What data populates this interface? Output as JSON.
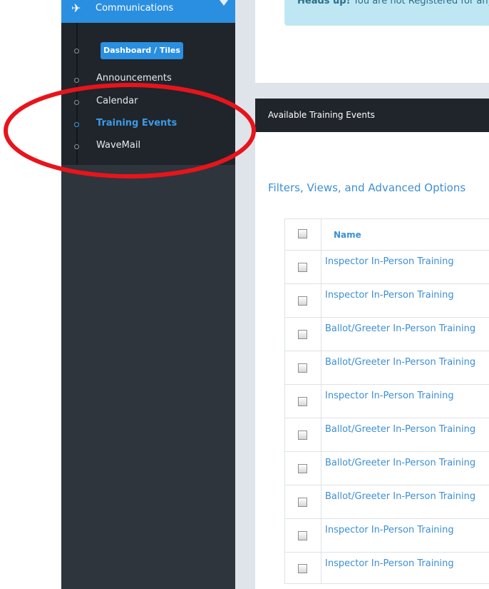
{
  "sidebar": {
    "section_label": "Communications",
    "section_icon": "paper-plane-icon",
    "dashboard_button": "Dashboard / Tiles",
    "items": [
      {
        "label": "Announcements",
        "active": false
      },
      {
        "label": "Calendar",
        "active": false
      },
      {
        "label": "Training Events",
        "active": true
      },
      {
        "label": "WaveMail",
        "active": false
      }
    ]
  },
  "alert": {
    "strong": "Heads up!",
    "text": "You are not Registered for any"
  },
  "panel": {
    "title": "Available Training Events",
    "filters_link": "Filters, Views, and Advanced Options"
  },
  "table": {
    "header": "Name",
    "rows": [
      "Inspector In-Person Training",
      "Inspector In-Person Training",
      "Ballot/Greeter In-Person Training",
      "Ballot/Greeter In-Person Training",
      "Inspector In-Person Training",
      "Ballot/Greeter In-Person Training",
      "Ballot/Greeter In-Person Training",
      "Ballot/Greeter In-Person Training",
      "Inspector In-Person Training",
      "Inspector In-Person Training"
    ]
  },
  "colors": {
    "accent": "#2a8fe0",
    "sidebar_dark": "#1f252b",
    "annotation": "#e8141b"
  }
}
